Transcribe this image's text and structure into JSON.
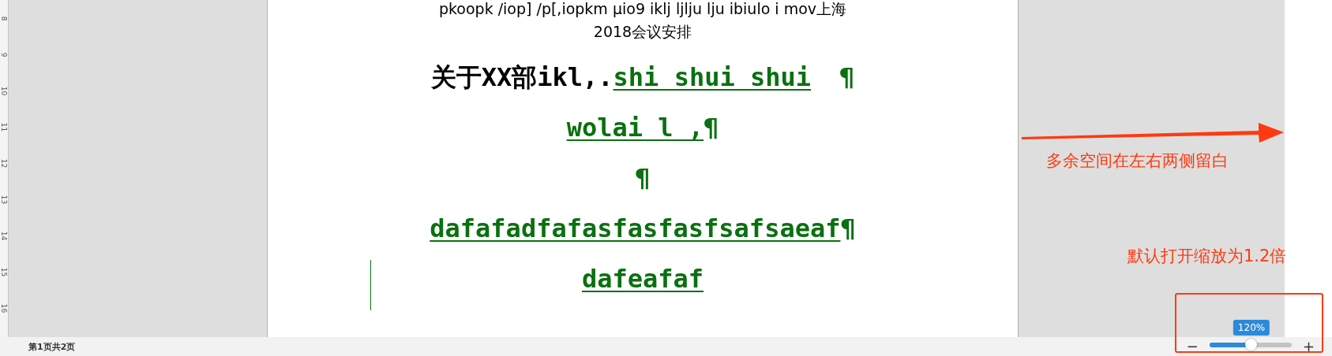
{
  "ruler": {
    "marks": [
      "8",
      "9",
      "10",
      "11",
      "12",
      "13",
      "14",
      "15",
      "16"
    ]
  },
  "document": {
    "lines": [
      {
        "kind": "small",
        "runs": [
          {
            "kind": "plain",
            "text": "pkoopk /iop] /p[,iopkm µio9 iklj ljlju lju ibiulo i mov上海"
          }
        ]
      },
      {
        "kind": "small",
        "runs": [
          {
            "kind": "plain",
            "text": "2018会议安排"
          }
        ]
      },
      {
        "kind": "large",
        "runs": [
          {
            "kind": "plain",
            "text": "关于XX部ikl,."
          },
          {
            "kind": "inserted",
            "text": "shi shui shui"
          },
          {
            "kind": "mark",
            "text": "¶"
          }
        ]
      },
      {
        "kind": "large",
        "runs": [
          {
            "kind": "inserted",
            "text": "wolai l ,"
          },
          {
            "kind": "mark",
            "text": "¶"
          }
        ]
      },
      {
        "kind": "large",
        "runs": [
          {
            "kind": "mark",
            "text": "¶"
          }
        ]
      },
      {
        "kind": "large",
        "runs": [
          {
            "kind": "inserted",
            "text": "dafafadfafasfasfasfsafsaeaf"
          },
          {
            "kind": "mark",
            "text": "¶"
          }
        ]
      },
      {
        "kind": "large",
        "runs": [
          {
            "kind": "inserted",
            "text": "dafeafaf"
          }
        ]
      }
    ]
  },
  "status_bar": {
    "page_info": "第1页共2页"
  },
  "zoom": {
    "minus": "−",
    "plus": "+",
    "tooltip": "120%",
    "level": 0.51
  },
  "annotations": [
    {
      "kind": "arrow",
      "text": "多余空间在左右两侧留白"
    },
    {
      "kind": "box",
      "text": "默认打开缩放为1.2倍"
    }
  ]
}
